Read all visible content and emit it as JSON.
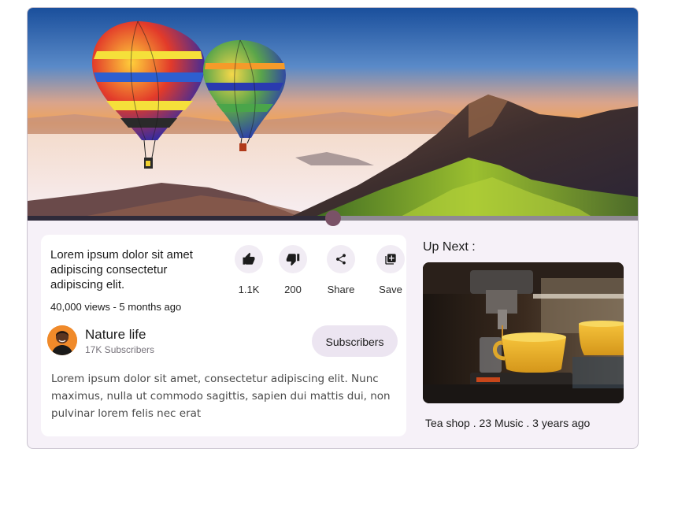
{
  "player": {
    "progress_fraction": 0.5
  },
  "video": {
    "title": "Lorem ipsum dolor sit amet adipiscing consectetur adipiscing elit.",
    "meta": "40,000 views - 5 months ago",
    "description": "Lorem ipsum dolor sit amet, consectetur adipiscing elit. Nunc maximus, nulla ut commodo sagittis, sapien dui mattis dui, non pulvinar lorem felis nec erat"
  },
  "actions": [
    {
      "label": "1.1K",
      "icon": "thumbs-up-icon"
    },
    {
      "label": "200",
      "icon": "thumbs-down-icon"
    },
    {
      "label": "Share",
      "icon": "share-icon"
    },
    {
      "label": "Save",
      "icon": "playlist-add-icon"
    }
  ],
  "channel": {
    "name": "Nature life",
    "subscribers": "17K Subscribers",
    "button_label": "Subscribers"
  },
  "up_next": {
    "heading": "Up Next :",
    "meta": "Tea shop . 23 Music . 3 years ago"
  },
  "colors": {
    "card_background": "#f6f1f8",
    "progress_handle": "#7a5267",
    "subscribe_button": "#ece5f1"
  }
}
